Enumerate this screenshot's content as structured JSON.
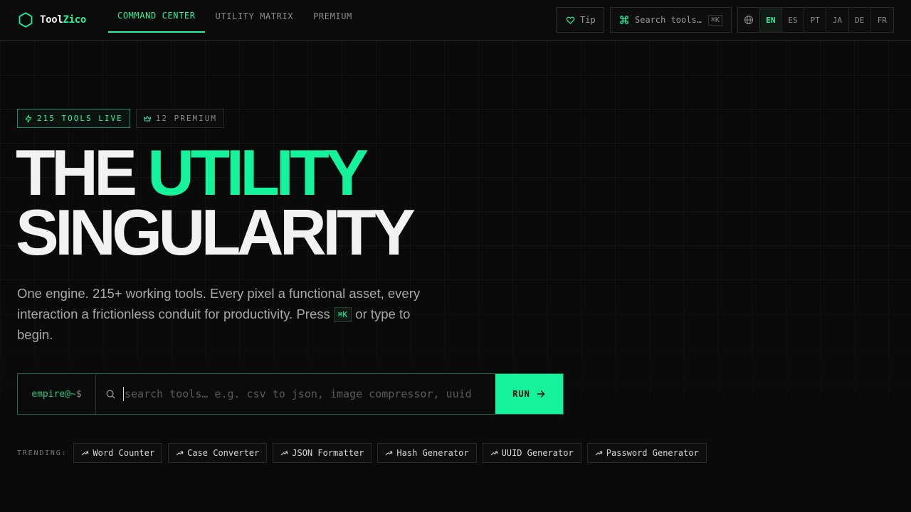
{
  "brand": {
    "name_part1": "Tool",
    "name_part2": "Zico",
    "accent_color": "#14f29b"
  },
  "nav": {
    "items": [
      {
        "label": "COMMAND CENTER",
        "active": true
      },
      {
        "label": "UTILITY MATRIX",
        "active": false
      },
      {
        "label": "PREMIUM",
        "active": false
      }
    ]
  },
  "header": {
    "tip_label": "Tip",
    "search_label": "Search tools…",
    "search_shortcut": "⌘K",
    "languages": [
      "EN",
      "ES",
      "PT",
      "JA",
      "DE",
      "FR"
    ],
    "active_language": "EN"
  },
  "hero": {
    "badge_live": "215 TOOLS LIVE",
    "badge_premium": "12 PREMIUM",
    "headline_part1": "THE ",
    "headline_accent": "UTILITY",
    "headline_line2": "SINGULARITY",
    "lede_before": "One engine. 215+ working tools. Every pixel a functional asset, every interaction a frictionless conduit for productivity. Press ",
    "lede_key": "⌘K",
    "lede_after": " or type to begin."
  },
  "command": {
    "prompt_user": "empire@~",
    "prompt_symbol": "$",
    "placeholder": "search tools… e.g. csv to json, image compressor, uuid",
    "value": "",
    "run_label": "RUN"
  },
  "trending": {
    "label": "TRENDING:",
    "items": [
      "Word Counter",
      "Case Converter",
      "JSON Formatter",
      "Hash Generator",
      "UUID Generator",
      "Password Generator"
    ]
  }
}
